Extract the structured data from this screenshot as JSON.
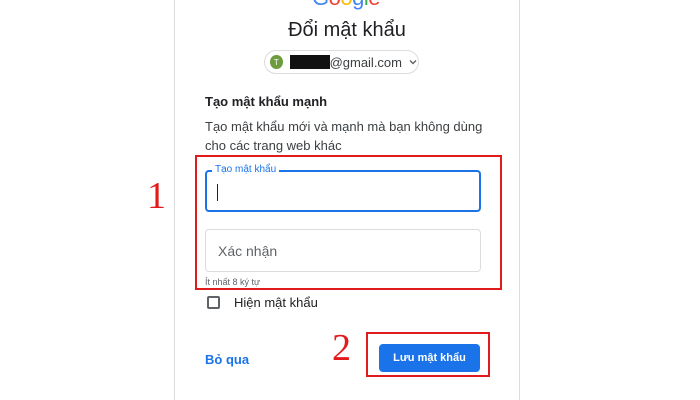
{
  "header": {
    "logo_letters": [
      {
        "ch": "G",
        "color": "#4285F4"
      },
      {
        "ch": "o",
        "color": "#EA4335"
      },
      {
        "ch": "o",
        "color": "#FBBC05"
      },
      {
        "ch": "g",
        "color": "#4285F4"
      },
      {
        "ch": "l",
        "color": "#34A853"
      },
      {
        "ch": "e",
        "color": "#EA4335"
      }
    ],
    "title": "Đổi mật khẩu"
  },
  "account": {
    "avatar_initial": "T",
    "avatar_color": "#6d9c3f",
    "email_domain": "@gmail.com",
    "chevron_icon": "chevron-down-icon"
  },
  "form": {
    "section_title": "Tạo mật khẩu mạnh",
    "description": "Tạo mật khẩu mới và mạnh mà bạn không dùng cho các trang web khác",
    "password_label": "Tạo mật khẩu",
    "password_value": "",
    "confirm_placeholder": "Xác nhận",
    "hint": "Ít nhất 8 ký tự",
    "show_password_label": "Hiện mật khẩu",
    "show_password_checked": false
  },
  "actions": {
    "skip_label": "Bỏ qua",
    "save_label": "Lưu mật khẩu"
  },
  "annotations": {
    "step1": "1",
    "step2": "2",
    "color": "#e11b1b"
  },
  "colors": {
    "accent": "#1a73e8"
  }
}
